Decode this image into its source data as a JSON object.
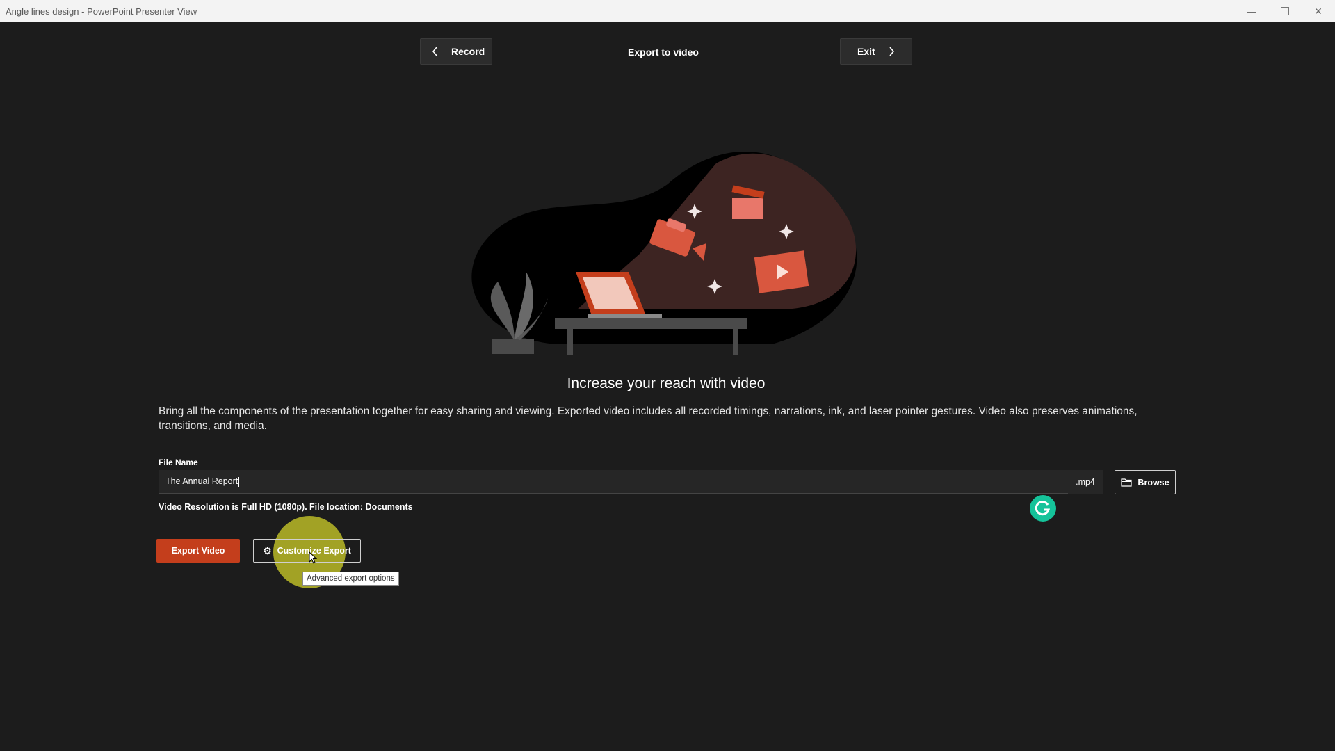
{
  "window": {
    "title": "Angle lines design - PowerPoint Presenter View"
  },
  "header": {
    "back_label": "Record",
    "title": "Export to video",
    "next_label": "Exit"
  },
  "main": {
    "heading": "Increase your reach with video",
    "description": "Bring all the components of the presentation together for easy sharing and viewing. Exported video includes all recorded timings, narrations, ink, and laser pointer gestures. Video also preserves animations, transitions, and media."
  },
  "form": {
    "file_name_label": "File Name",
    "file_name_value": "The Annual Report",
    "extension": ".mp4",
    "browse_label": "Browse",
    "resolution_text": "Video Resolution is Full HD (1080p).",
    "location_text": "File location: Documents"
  },
  "actions": {
    "export_label": "Export Video",
    "customize_label": "Customize Export",
    "tooltip": "Advanced export options"
  },
  "colors": {
    "accent": "#c43e1c",
    "background": "#1c1c1c",
    "grammarly": "#15c39a"
  }
}
